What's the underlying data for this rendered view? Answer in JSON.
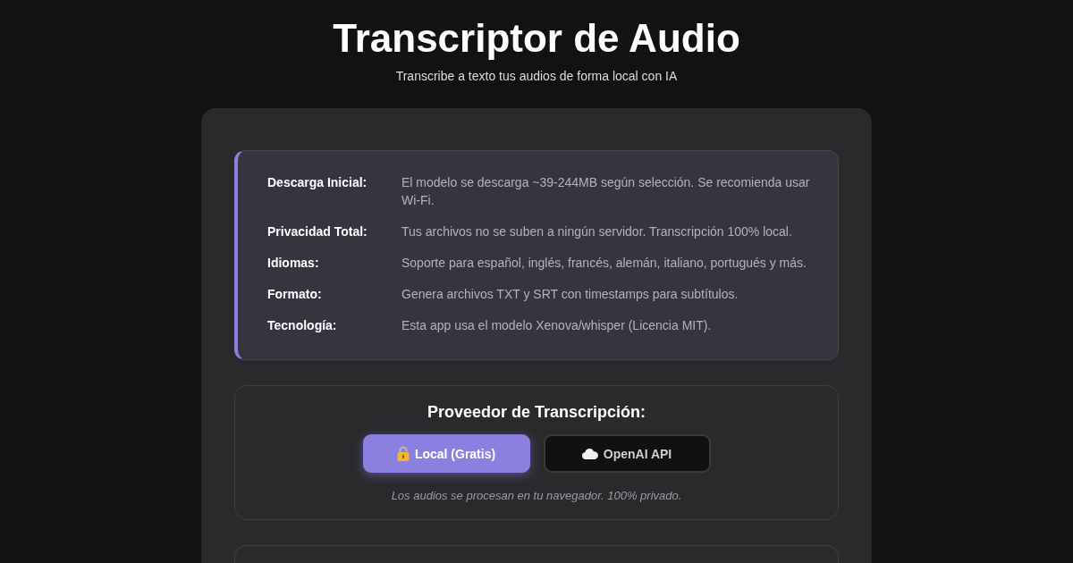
{
  "header": {
    "title": "Transcriptor de Audio",
    "subtitle": "Transcribe a texto tus audios de forma local con IA"
  },
  "info": [
    {
      "label": "Descarga Inicial:",
      "text": "El modelo se descarga ~39-244MB según selección. Se recomienda usar Wi-Fi."
    },
    {
      "label": "Privacidad Total:",
      "text": "Tus archivos no se suben a ningún servidor. Transcripción 100% local."
    },
    {
      "label": "Idiomas:",
      "text": "Soporte para español, inglés, francés, alemán, italiano, portugués y más."
    },
    {
      "label": "Formato:",
      "text": "Genera archivos TXT y SRT con timestamps para subtítulos."
    },
    {
      "label": "Tecnología:",
      "text": "Esta app usa el modelo Xenova/whisper (Licencia MIT)."
    }
  ],
  "provider": {
    "title": "Proveedor de Transcripción:",
    "options": [
      {
        "kind": "lock",
        "label": "Local (Gratis)",
        "selected": true
      },
      {
        "kind": "cloud",
        "label": "OpenAI API",
        "selected": false
      }
    ],
    "note": "Los audios se procesan en tu navegador. 100% privado."
  }
}
